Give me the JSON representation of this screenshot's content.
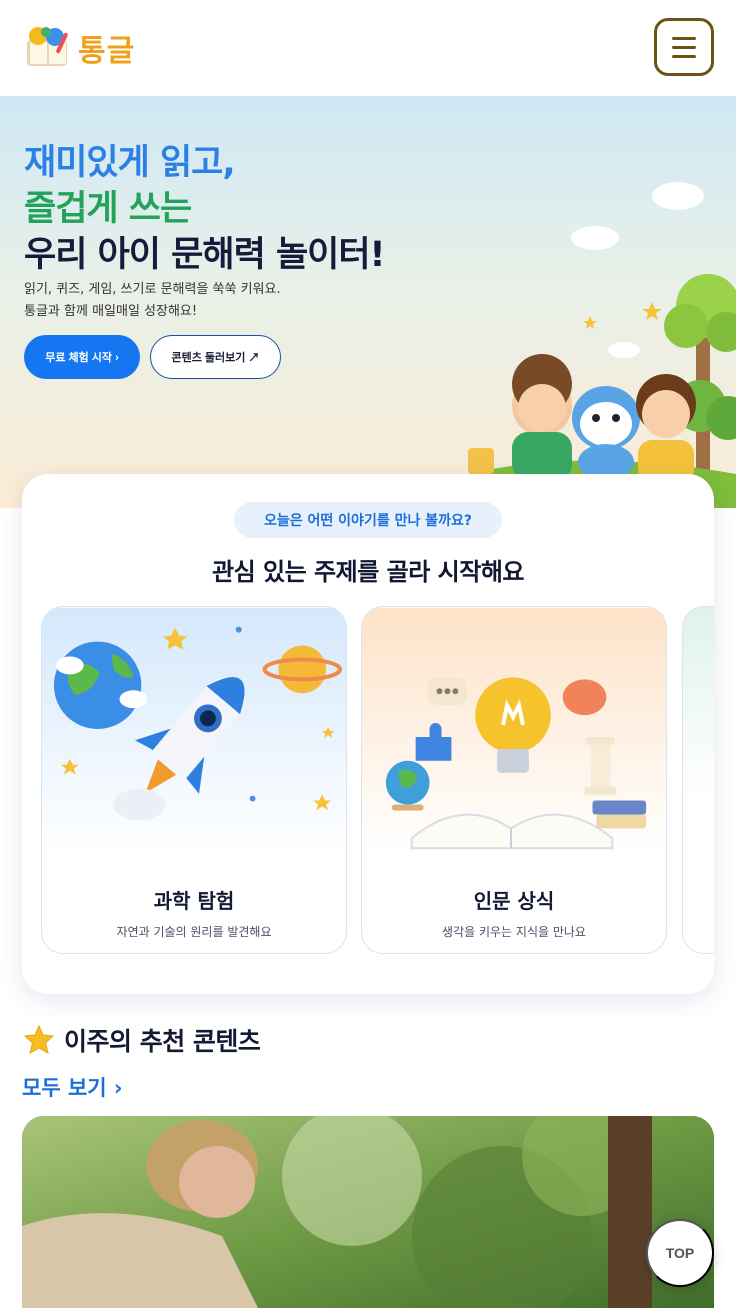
{
  "header": {
    "brand": "통글",
    "logo_icon": "book-logo-icon",
    "menu_icon": "hamburger-menu-icon"
  },
  "hero": {
    "title_line1": "재미있게 읽고,",
    "title_line2": "즐겁게 쓰는",
    "title_line3": "우리 아이 문해력 놀이터!",
    "desc_line1": "읽기, 퀴즈, 게임, 쓰기로 문해력을 쑥쑥 키워요.",
    "desc_line2": "통글과 함께 매일매일 성장해요!",
    "primary_button": "무료 체험 시작 ›",
    "secondary_button": "콘텐츠 둘러보기 ↗",
    "colors": {
      "line1": "#2b80e6",
      "line2": "#23a35a",
      "line3": "#151b3a",
      "primary": "#1476f0"
    }
  },
  "topics": {
    "pill": "오늘은 어떤 이야기를 만나 볼까요?",
    "heading": "관심 있는 주제를 골라 시작해요",
    "items": [
      {
        "title": "과학 탐험",
        "subtitle": "자연과 기술의 원리를 발견해요",
        "art": "rocket-planet-illustration"
      },
      {
        "title": "인문 상식",
        "subtitle": "생각을 키우는 지식을 만나요",
        "art": "lightbulb-book-illustration"
      }
    ]
  },
  "recommended": {
    "title": "이주의 추천 콘텐츠",
    "icon": "star-icon",
    "see_all": "모두 보기 ›",
    "card_image": "forest-researcher-photo"
  },
  "top_button": "TOP"
}
